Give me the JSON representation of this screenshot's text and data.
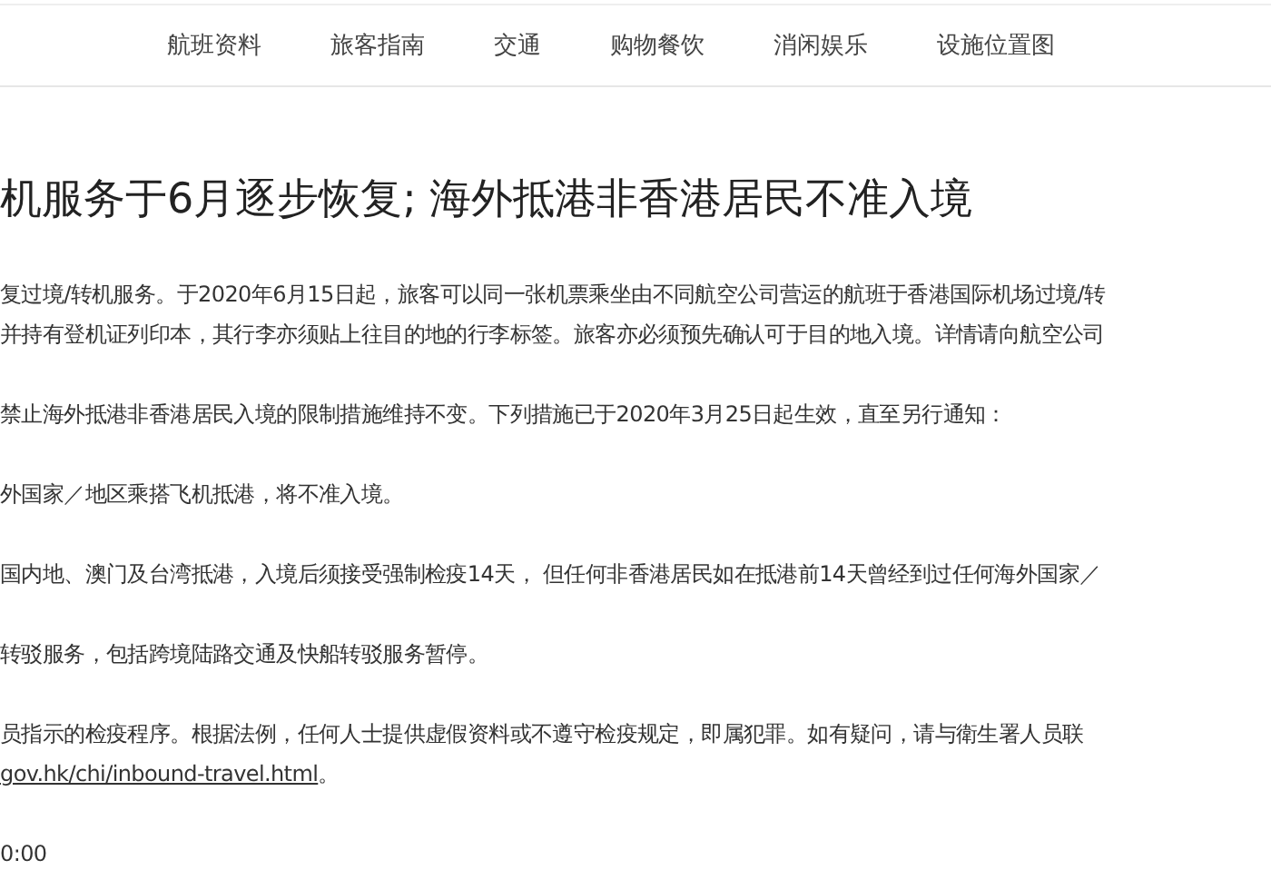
{
  "nav": [
    "航班资料",
    "旅客指南",
    "交通",
    "购物餐饮",
    "消闲娱乐",
    "设施位置图"
  ],
  "title": "机服务于6月逐步恢复; 海外抵港非香港居民不准入境",
  "paragraphs": [
    {
      "kind": "text",
      "lines": [
        "复过境/转机服务。于2020年6月15日起，旅客可以同一张机票乘坐由不同航空公司营运的航班于香港国际机场过境/转",
        "并持有登机证列印本，其行李亦须贴上往目的地的行李标签。旅客亦必须预先确认可于目的地入境。详情请向航空公司"
      ]
    },
    {
      "kind": "text",
      "lines": [
        "禁止海外抵港非香港居民入境的限制措施维持不变。下列措施已于2020年3月25日起生效，直至另行通知："
      ]
    },
    {
      "kind": "text",
      "lines": [
        "外国家／地区乘搭飞机抵港，将不准入境。"
      ]
    },
    {
      "kind": "text",
      "lines": [
        "国内地、澳门及台湾抵港，入境后须接受强制检疫14天， 但任何非香港居民如在抵港前14天曾经到过任何海外国家／"
      ]
    },
    {
      "kind": "text",
      "lines": [
        "转驳服务，包括跨境陆路交通及快船转驳服务暂停。"
      ]
    },
    {
      "kind": "link",
      "lines": [
        "员指示的检疫程序。根据法例，任何人士提供虚假资料或不遵守检疫规定，即属犯罪。如有疑问，请与衛生署人员联"
      ],
      "link": "gov.hk/chi/inbound-travel.html",
      "suffix": "。"
    },
    {
      "kind": "text",
      "lines": [
        "0:00"
      ]
    }
  ]
}
